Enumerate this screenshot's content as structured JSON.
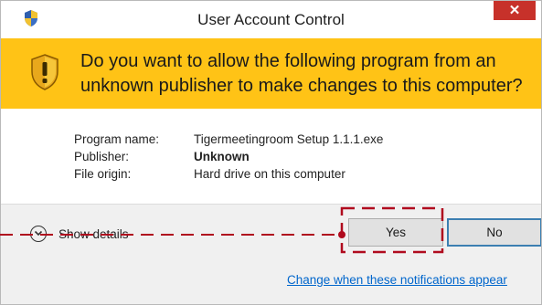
{
  "window": {
    "title": "User Account Control",
    "close_label": "✕"
  },
  "banner": {
    "question": "Do you want to allow the following program from an unknown publisher to make changes to this computer?",
    "color": "#ffc316"
  },
  "details": {
    "program_name_label": "Program name:",
    "program_name_value": "Tigermeetingroom Setup 1.1.1.exe",
    "publisher_label": "Publisher:",
    "publisher_value": "Unknown",
    "file_origin_label": "File origin:",
    "file_origin_value": "Hard drive on this computer"
  },
  "footer": {
    "show_details_label": "Show details",
    "yes_label": "Yes",
    "no_label": "No",
    "notifications_link": "Change when these notifications appear"
  },
  "annotation": {
    "color": "#b00b1e",
    "style": "dashed"
  },
  "icons": {
    "title": "uac-shield-icon",
    "banner": "warning-shield-icon",
    "details_toggle": "chevron-down-icon",
    "close": "close-icon"
  }
}
